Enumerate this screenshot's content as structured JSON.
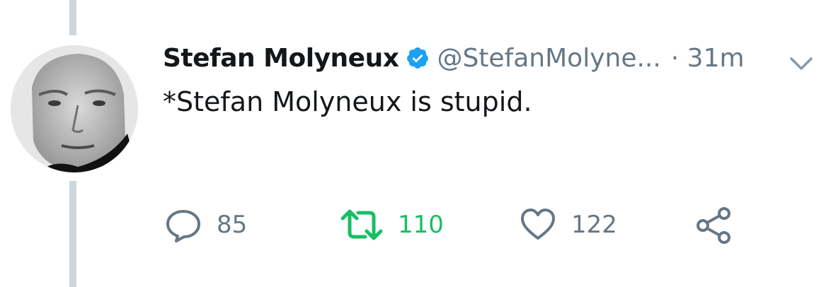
{
  "tweet": {
    "display_name": "Stefan Molyneux",
    "handle": "@StefanMolyne...",
    "time": "· 31m",
    "text": "*Stefan Molyneux is stupid.",
    "verified": true
  },
  "actions": {
    "reply_count": "85",
    "retweet_count": "110",
    "like_count": "122"
  },
  "icons": {
    "verified": "verified-badge-icon",
    "caret": "chevron-down-icon",
    "reply": "reply-icon",
    "retweet": "retweet-icon",
    "like": "heart-icon",
    "share": "share-icon"
  },
  "colors": {
    "verified_blue": "#1da1f2",
    "retweeted_green": "#17bf63",
    "muted_gray": "#657786",
    "thread_line": "#ccd6dd"
  }
}
